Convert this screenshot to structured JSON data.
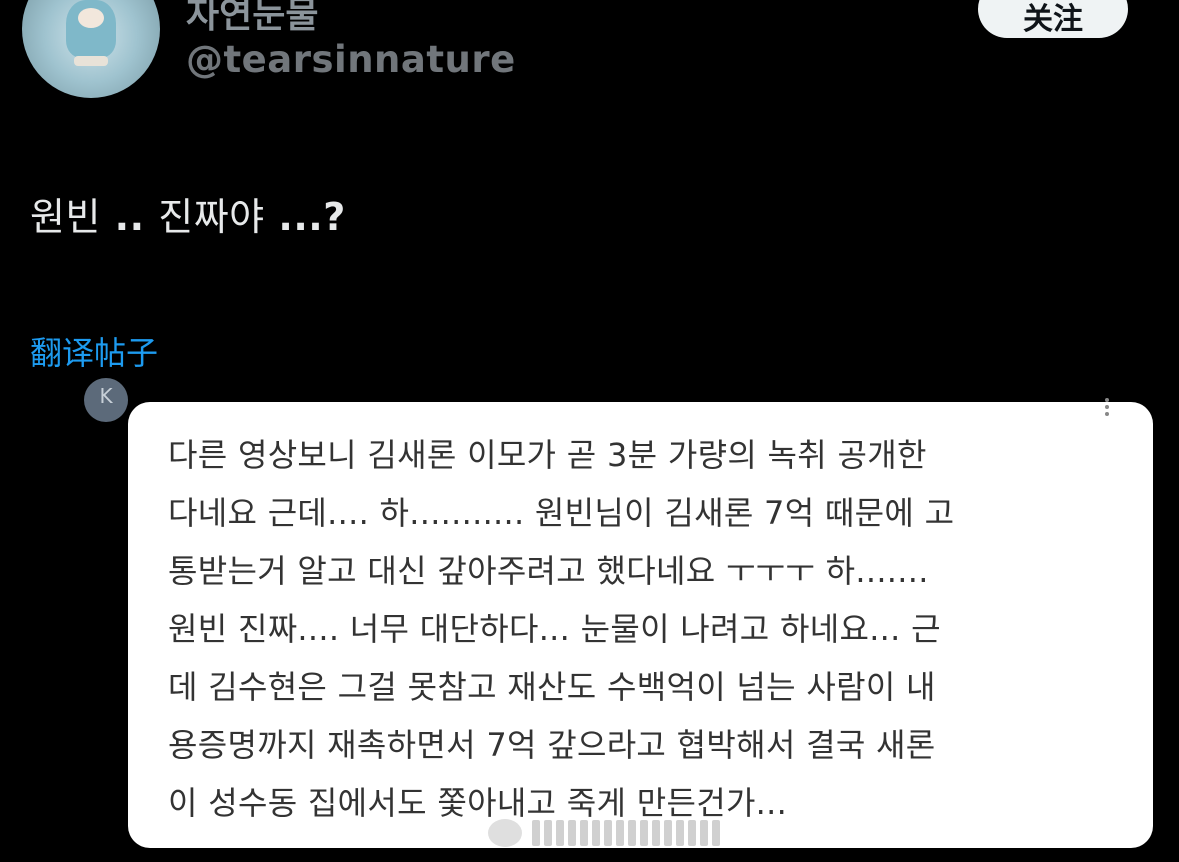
{
  "header": {
    "display_name": "자연눈물",
    "handle": "@tearsinnature",
    "follow_label": "关注"
  },
  "post": {
    "text_part1": "원빈",
    "text_part2": " .. ",
    "text_part3": "진짜야",
    "text_part4": " ...?",
    "translate_label": "翻译帖子"
  },
  "quoted": {
    "avatar_initial": "K",
    "lines": [
      "다른 영상보니 김새론 이모가 곧 3분 가량의 녹취 공개한",
      "다네요 근데.... 하........... 원빈님이 김새론 7억 때문에 고",
      "통받는거 알고 대신 갚아주려고 했다네요 ㅜㅜㅜ 하.......",
      "원빈 진짜.... 너무 대단하다... 눈물이 나려고 하네요... 근",
      "데 김수현은 그걸 못참고 재산도 수백억이 넘는 사람이 내",
      "용증명까지 재촉하면서 7억 갚으라고 협박해서 결국 새론",
      "이 성수동 집에서도 쫓아내고 죽게 만든건가..."
    ]
  },
  "colors": {
    "background": "#000000",
    "link": "#1d9bf0",
    "handle": "#71767b",
    "card": "#ffffff"
  },
  "icons": {
    "more": "more-vertical-icon",
    "watermark": "watermark-logo-icon"
  }
}
